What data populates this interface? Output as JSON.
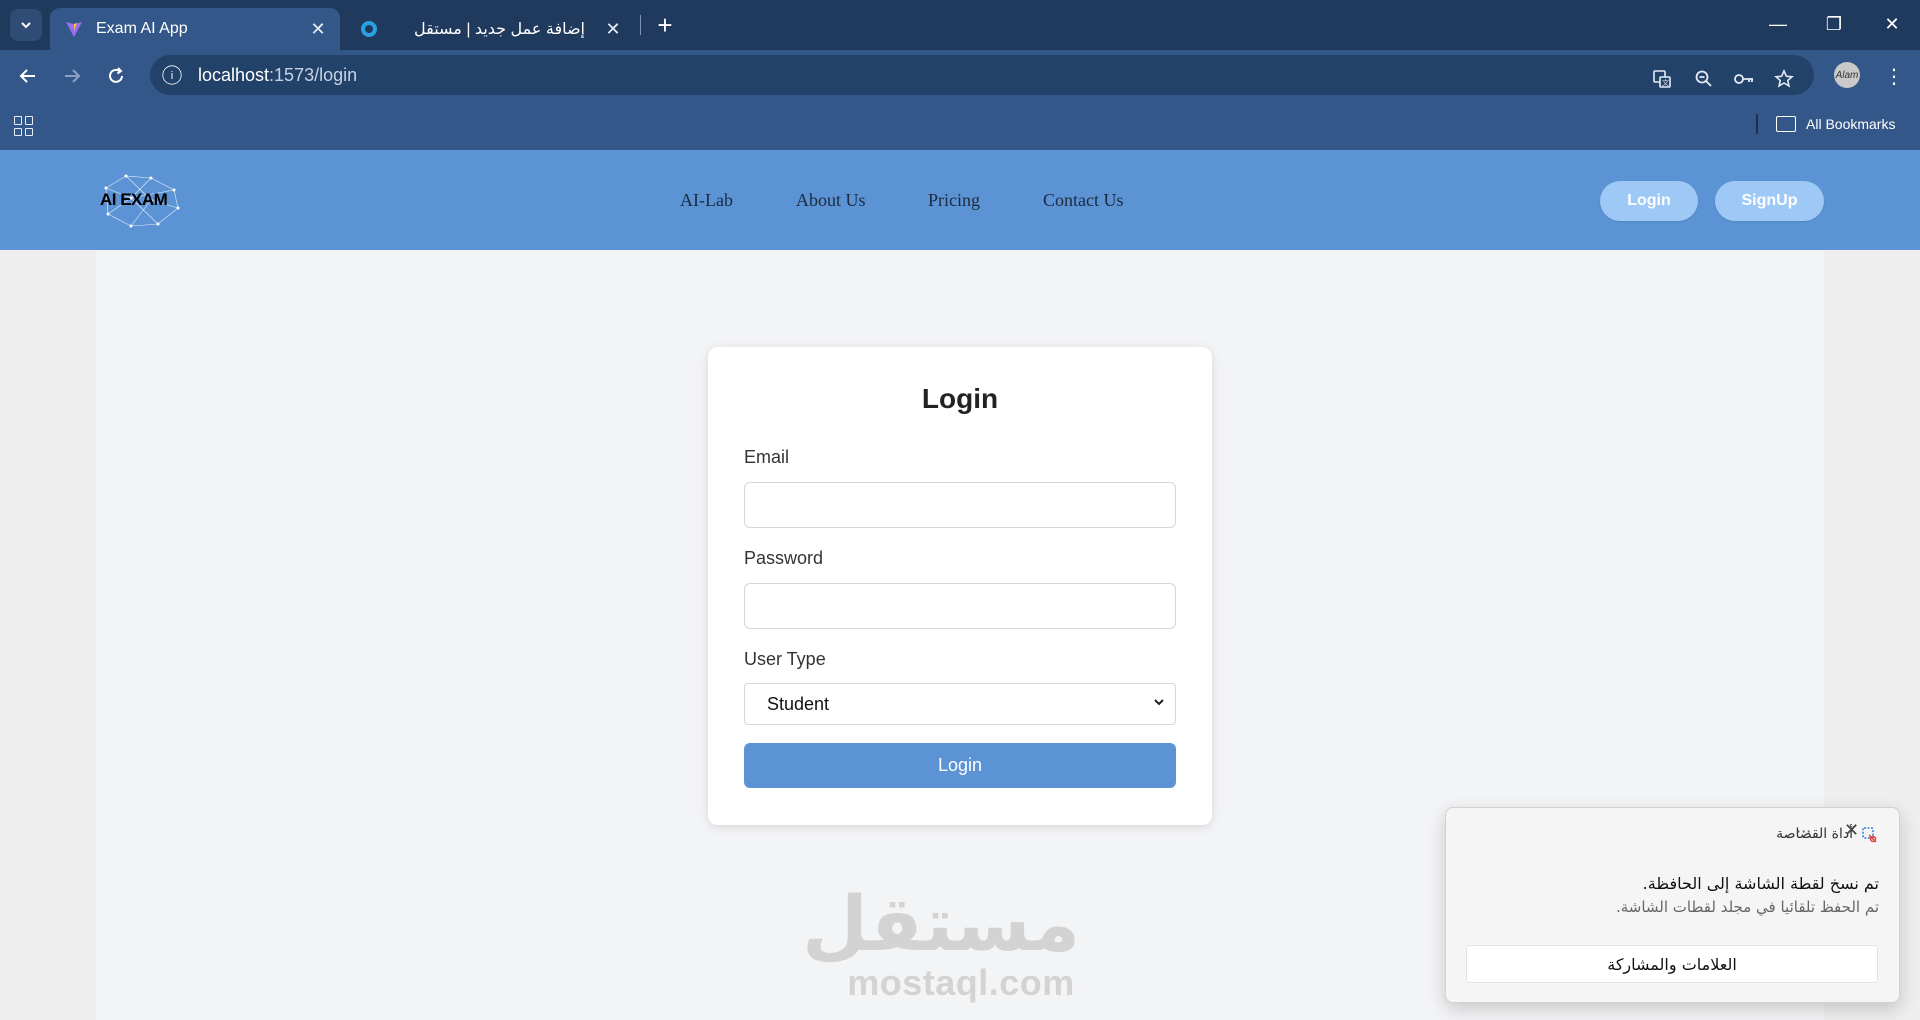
{
  "browser": {
    "tabs": [
      {
        "title": "Exam AI App",
        "active": true
      },
      {
        "title": "إضافة عمل جديد | مستقل",
        "active": false
      }
    ],
    "url_host": "localhost",
    "url_path": ":1573/login",
    "bookmarks_label": "All Bookmarks"
  },
  "site": {
    "logo_text": "AI EXAM",
    "nav": [
      "AI-Lab",
      "About Us",
      "Pricing",
      "Contact Us"
    ],
    "login_button": "Login",
    "signup_button": "SignUp"
  },
  "login_form": {
    "title": "Login",
    "email_label": "Email",
    "password_label": "Password",
    "user_type_label": "User Type",
    "user_type_selected": "Student",
    "submit_label": "Login"
  },
  "watermark": {
    "arabic": "مستقل",
    "latin": "mostaql.com"
  },
  "notification": {
    "app_name": "أداة القصاصة",
    "message": "تم نسخ لقطة الشاشة إلى الحافظة.",
    "detail": "تم الحفظ تلقائيا في مجلد لقطات الشاشة.",
    "action": "العلامات والمشاركة"
  },
  "colors": {
    "chrome_dark": "#1f3a5c",
    "chrome": "#34578a",
    "nav_blue": "#5b93d5",
    "pill": "#9ec8f5"
  }
}
